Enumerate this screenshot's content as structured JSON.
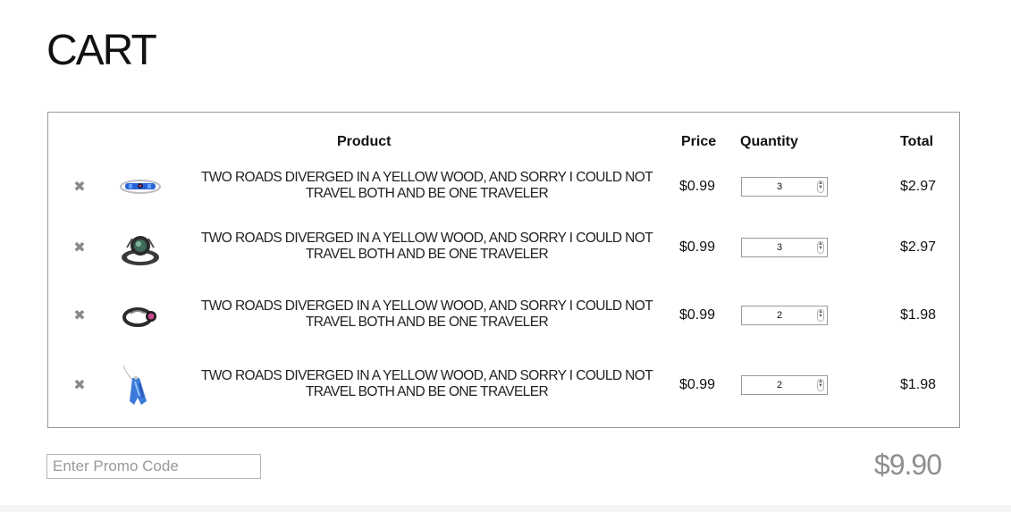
{
  "page": {
    "title": "CART"
  },
  "table": {
    "headers": {
      "product": "Product",
      "price": "Price",
      "quantity": "Quantity",
      "total": "Total"
    }
  },
  "items": [
    {
      "icon": "remove-x-icon",
      "image": "ring-blue-opal-thumbnail",
      "name": "TWO ROADS DIVERGED IN A YELLOW WOOD, AND SORRY I COULD NOT TRAVEL BOTH AND BE ONE TRAVELER",
      "price": "$0.99",
      "quantity": "3",
      "total": "$2.97"
    },
    {
      "icon": "remove-x-icon",
      "image": "ring-dark-gem-thumbnail",
      "name": "TWO ROADS DIVERGED IN A YELLOW WOOD, AND SORRY I COULD NOT TRAVEL BOTH AND BE ONE TRAVELER",
      "price": "$0.99",
      "quantity": "3",
      "total": "$2.97"
    },
    {
      "icon": "remove-x-icon",
      "image": "ring-black-pink-thumbnail",
      "name": "TWO ROADS DIVERGED IN A YELLOW WOOD, AND SORRY I COULD NOT TRAVEL BOTH AND BE ONE TRAVELER",
      "price": "$0.99",
      "quantity": "2",
      "total": "$1.98"
    },
    {
      "icon": "remove-x-icon",
      "image": "whale-tail-pendant-thumbnail",
      "name": "TWO ROADS DIVERGED IN A YELLOW WOOD, AND SORRY I COULD NOT TRAVEL BOTH AND BE ONE TRAVELER",
      "price": "$0.99",
      "quantity": "2",
      "total": "$1.98"
    }
  ],
  "promo": {
    "placeholder": "Enter Promo Code",
    "value": ""
  },
  "summary": {
    "grand_total": "$9.90"
  },
  "colors": {
    "border": "#9a9a9a",
    "grand_total": "#8e8e8e",
    "remove_icon": "#8a8a8a"
  }
}
